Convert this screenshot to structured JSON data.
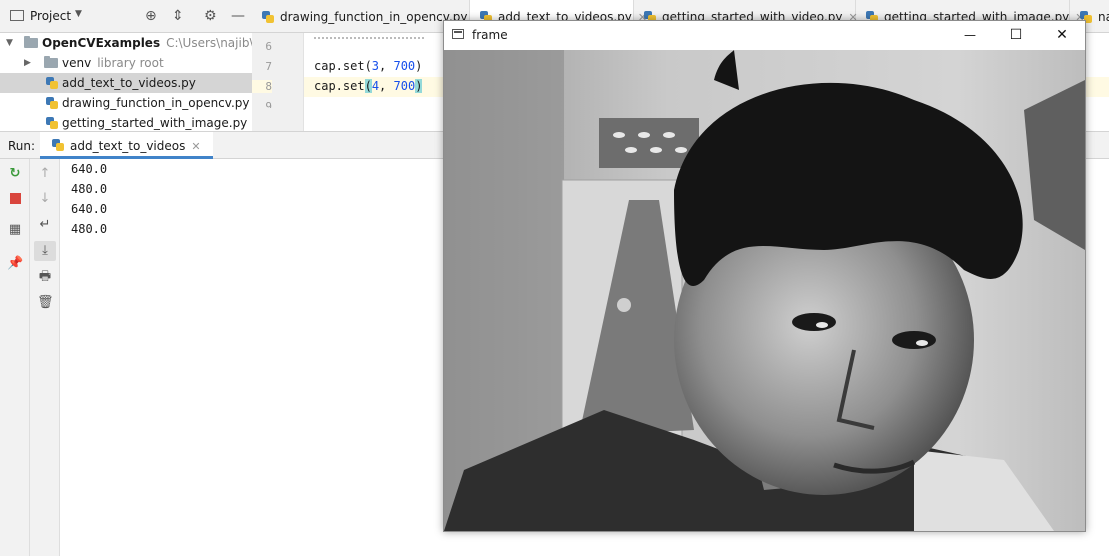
{
  "project_panel": {
    "title": "Project",
    "root_name": "OpenCVExamples",
    "root_path": "C:\\Users\\najib\\Pycha",
    "venv_label": "venv",
    "venv_hint": "library root",
    "files": [
      "add_text_to_videos.py",
      "drawing_function_in_opencv.py",
      "getting_started_with_image.py"
    ],
    "selected_file": "add_text_to_videos.py"
  },
  "editor": {
    "tabs": [
      "drawing_function_in_opencv.py",
      "add_text_to_videos.py",
      "getting_started_with_video.py",
      "getting_started_with_image.py",
      "najib_"
    ],
    "active_tab": "add_text_to_videos.py",
    "line_numbers": [
      "6",
      "7",
      "8",
      "9"
    ],
    "code_lines": {
      "line7_fn": "cap.set(",
      "line7_a": "3",
      "line7_sep": ", ",
      "line7_b": "700",
      "line7_end": ")",
      "line8_fn": "cap.set",
      "line8_open": "(",
      "line8_a": "4",
      "line8_sep": ", ",
      "line8_b": "700",
      "line8_close": ")"
    }
  },
  "run_panel": {
    "label": "Run:",
    "tab_label": "add_text_to_videos",
    "output_lines": [
      "640.0",
      "480.0",
      "640.0",
      "480.0"
    ]
  },
  "frame_window": {
    "title": "frame",
    "controls": {
      "minimize": "—",
      "maximize": "☐",
      "close": "✕"
    },
    "image_description_icon": "webcam-frame"
  },
  "colors": {
    "accent": "#4083c9",
    "number_literal": "#1750eb",
    "current_line": "#fffae3",
    "selection_row": "#d5d5d5"
  }
}
